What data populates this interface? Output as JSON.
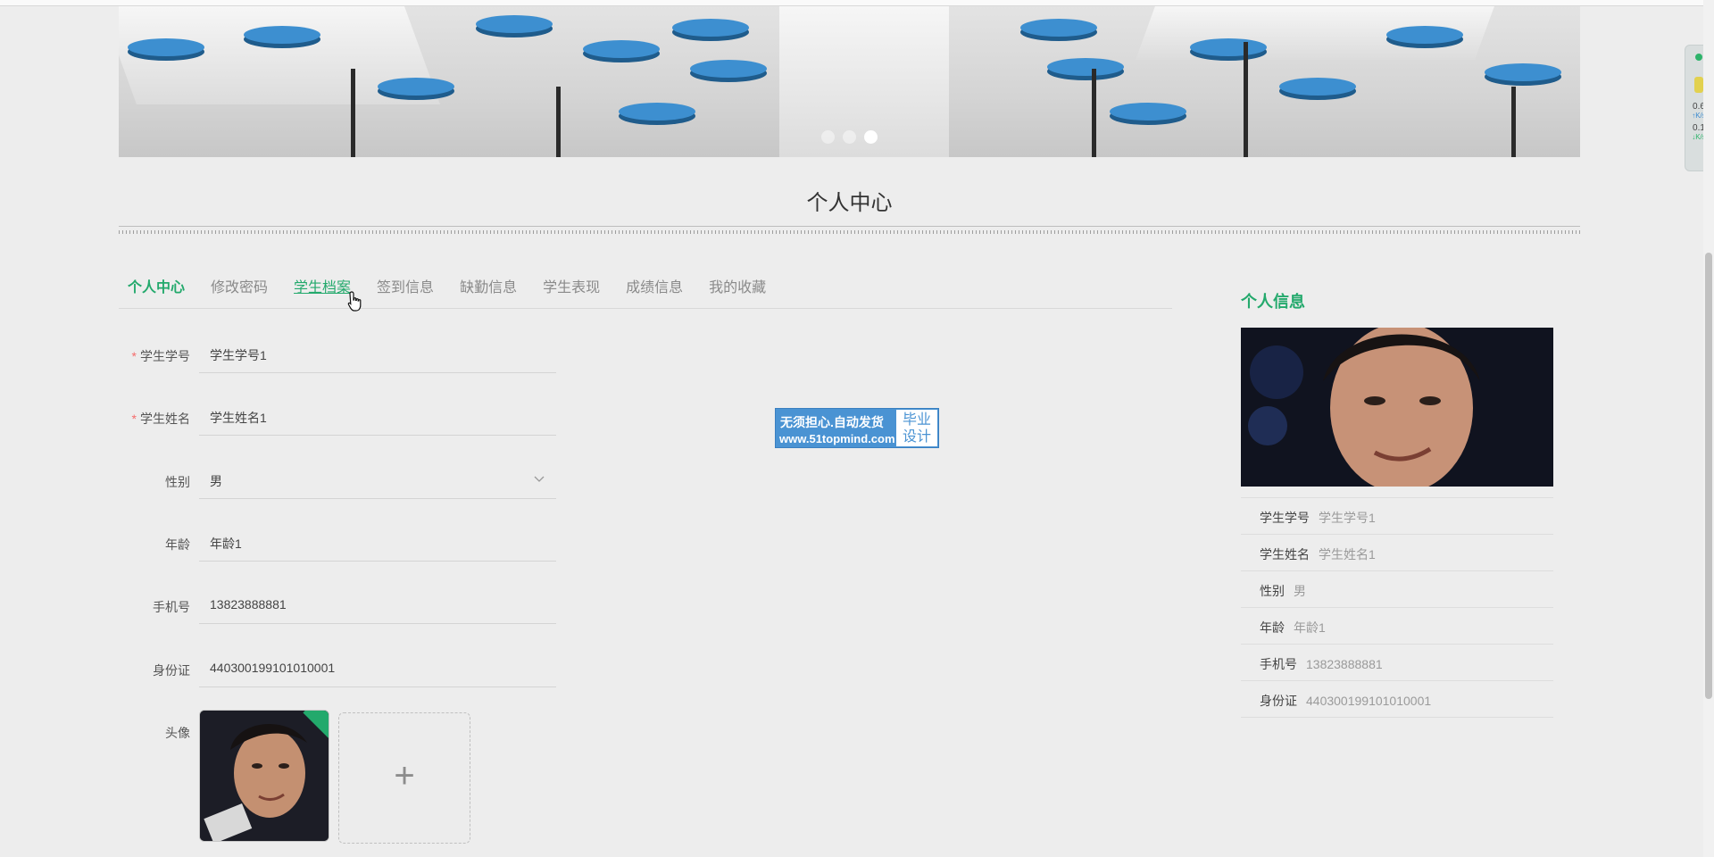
{
  "carousel": {
    "slides": 3,
    "active": 3
  },
  "page_title": "个人中心",
  "tabs": [
    {
      "label": "个人中心",
      "active": true
    },
    {
      "label": "修改密码"
    },
    {
      "label": "学生档案",
      "hover": true
    },
    {
      "label": "签到信息"
    },
    {
      "label": "缺勤信息"
    },
    {
      "label": "学生表现"
    },
    {
      "label": "成绩信息"
    },
    {
      "label": "我的收藏"
    }
  ],
  "form": {
    "student_id": {
      "label": "学生学号",
      "value": "学生学号1",
      "required": true
    },
    "student_name": {
      "label": "学生姓名",
      "value": "学生姓名1",
      "required": true
    },
    "gender": {
      "label": "性别",
      "value": "男"
    },
    "age": {
      "label": "年龄",
      "value": "年龄1"
    },
    "phone": {
      "label": "手机号",
      "value": "13823888881"
    },
    "id_card": {
      "label": "身份证",
      "value": "440300199101010001"
    },
    "avatar": {
      "label": "头像",
      "upload_icon": "+"
    }
  },
  "watermark": {
    "line1": "无须担心.自动发货",
    "line2": "www.51topmind.com",
    "box_top": "毕业",
    "box_bottom": "设计"
  },
  "info_panel": {
    "title": "个人信息",
    "items": [
      {
        "key": "学生学号",
        "value": "学生学号1"
      },
      {
        "key": "学生姓名",
        "value": "学生姓名1"
      },
      {
        "key": "性别",
        "value": "男"
      },
      {
        "key": "年龄",
        "value": "年龄1"
      },
      {
        "key": "手机号",
        "value": "13823888881"
      },
      {
        "key": "身份证",
        "value": "440300199101010001"
      }
    ]
  },
  "net_widget": {
    "up": "0.6",
    "up_unit": "K/s",
    "down": "0.1",
    "down_unit": "K/s"
  },
  "colors": {
    "accent": "#23a96c",
    "required": "#f56c6c",
    "watermark": "#4a93d3"
  },
  "icons": {
    "cursor": "hand-pointer-icon",
    "select": "chevron-down-icon",
    "upload": "plus-icon"
  }
}
